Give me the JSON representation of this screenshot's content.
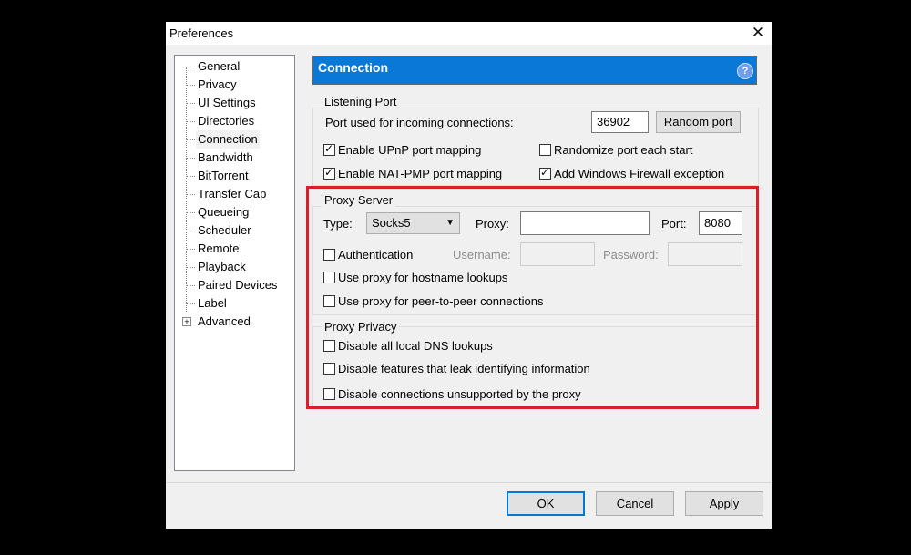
{
  "window": {
    "title": "Preferences"
  },
  "sidebar": {
    "items": [
      {
        "label": "General"
      },
      {
        "label": "Privacy"
      },
      {
        "label": "UI Settings"
      },
      {
        "label": "Directories"
      },
      {
        "label": "Connection"
      },
      {
        "label": "Bandwidth"
      },
      {
        "label": "BitTorrent"
      },
      {
        "label": "Transfer Cap"
      },
      {
        "label": "Queueing"
      },
      {
        "label": "Scheduler"
      },
      {
        "label": "Remote"
      },
      {
        "label": "Playback"
      },
      {
        "label": "Paired Devices"
      },
      {
        "label": "Label"
      },
      {
        "label": "Advanced"
      }
    ],
    "selected": "Connection"
  },
  "header": {
    "title": "Connection",
    "help_icon": "?"
  },
  "listening_port": {
    "group_label": "Listening Port",
    "port_label": "Port used for incoming connections:",
    "port_value": "36902",
    "random_port_button": "Random port",
    "enable_upnp": {
      "label": "Enable UPnP port mapping",
      "checked": true
    },
    "enable_natpmp": {
      "label": "Enable NAT-PMP port mapping",
      "checked": true
    },
    "randomize_port": {
      "label": "Randomize port each start",
      "checked": false
    },
    "firewall_exception": {
      "label": "Add Windows Firewall exception",
      "checked": true
    }
  },
  "proxy_server": {
    "group_label": "Proxy Server",
    "type_label": "Type:",
    "type_value": "Socks5",
    "proxy_label": "Proxy:",
    "proxy_value": "",
    "port_label": "Port:",
    "port_value": "8080",
    "authentication": {
      "label": "Authentication",
      "checked": false
    },
    "username_label": "Username:",
    "password_label": "Password:",
    "hostname_lookups": {
      "label": "Use proxy for hostname lookups",
      "checked": false
    },
    "p2p_connections": {
      "label": "Use proxy for peer-to-peer connections",
      "checked": false
    }
  },
  "proxy_privacy": {
    "group_label": "Proxy Privacy",
    "disable_dns": {
      "label": "Disable all local DNS lookups",
      "checked": false
    },
    "disable_leak": {
      "label": "Disable features that leak identifying information",
      "checked": false
    },
    "disable_unsupported": {
      "label": "Disable connections unsupported by the proxy",
      "checked": false
    }
  },
  "footer": {
    "ok": "OK",
    "cancel": "Cancel",
    "apply": "Apply"
  },
  "colors": {
    "header_blue": "#0a78d7",
    "highlight_red": "#d6202a"
  }
}
